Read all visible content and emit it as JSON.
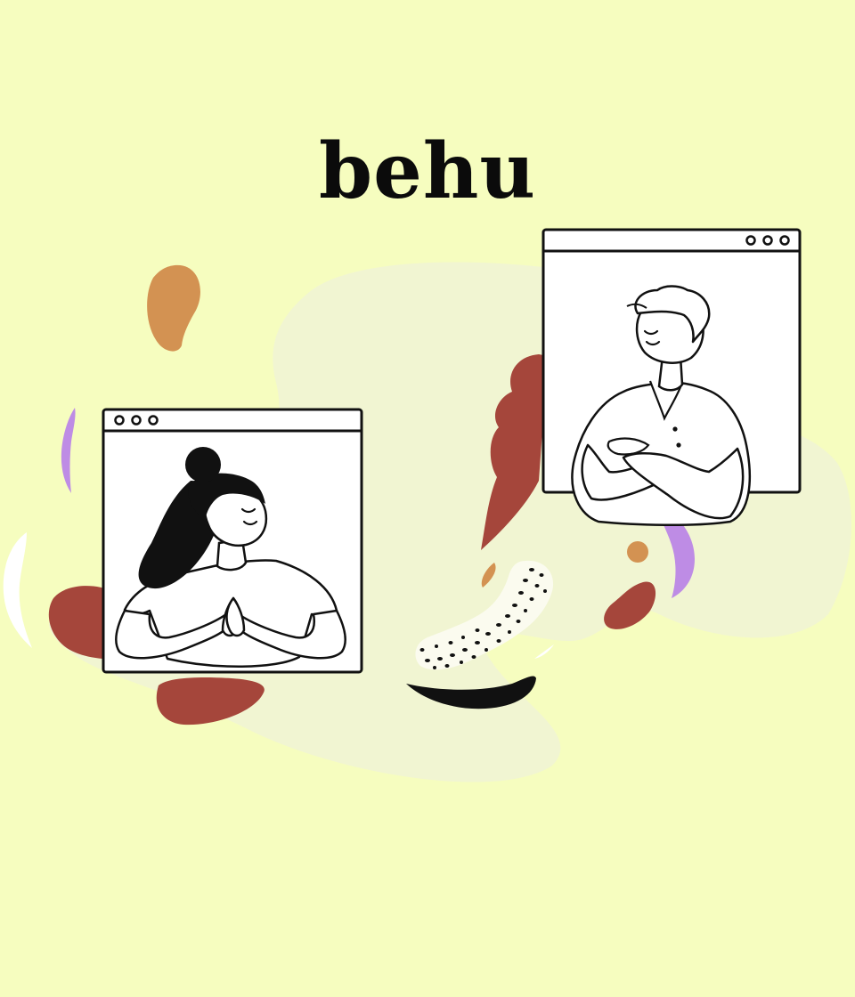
{
  "brand": {
    "title": "behu"
  },
  "palette": {
    "background": "#F6FDBF",
    "blob": "#F1F5D2",
    "rust": "#A5463B",
    "ochre": "#D39252",
    "lavender": "#BE8CE5",
    "ink": "#0b0b0b",
    "paper": "#FFFFFF"
  },
  "illustration": {
    "left_window": {
      "subject": "woman-with-hair-bun-namaste",
      "dots": 3
    },
    "right_window": {
      "subject": "man-arms-crossed",
      "dots": 3
    }
  }
}
